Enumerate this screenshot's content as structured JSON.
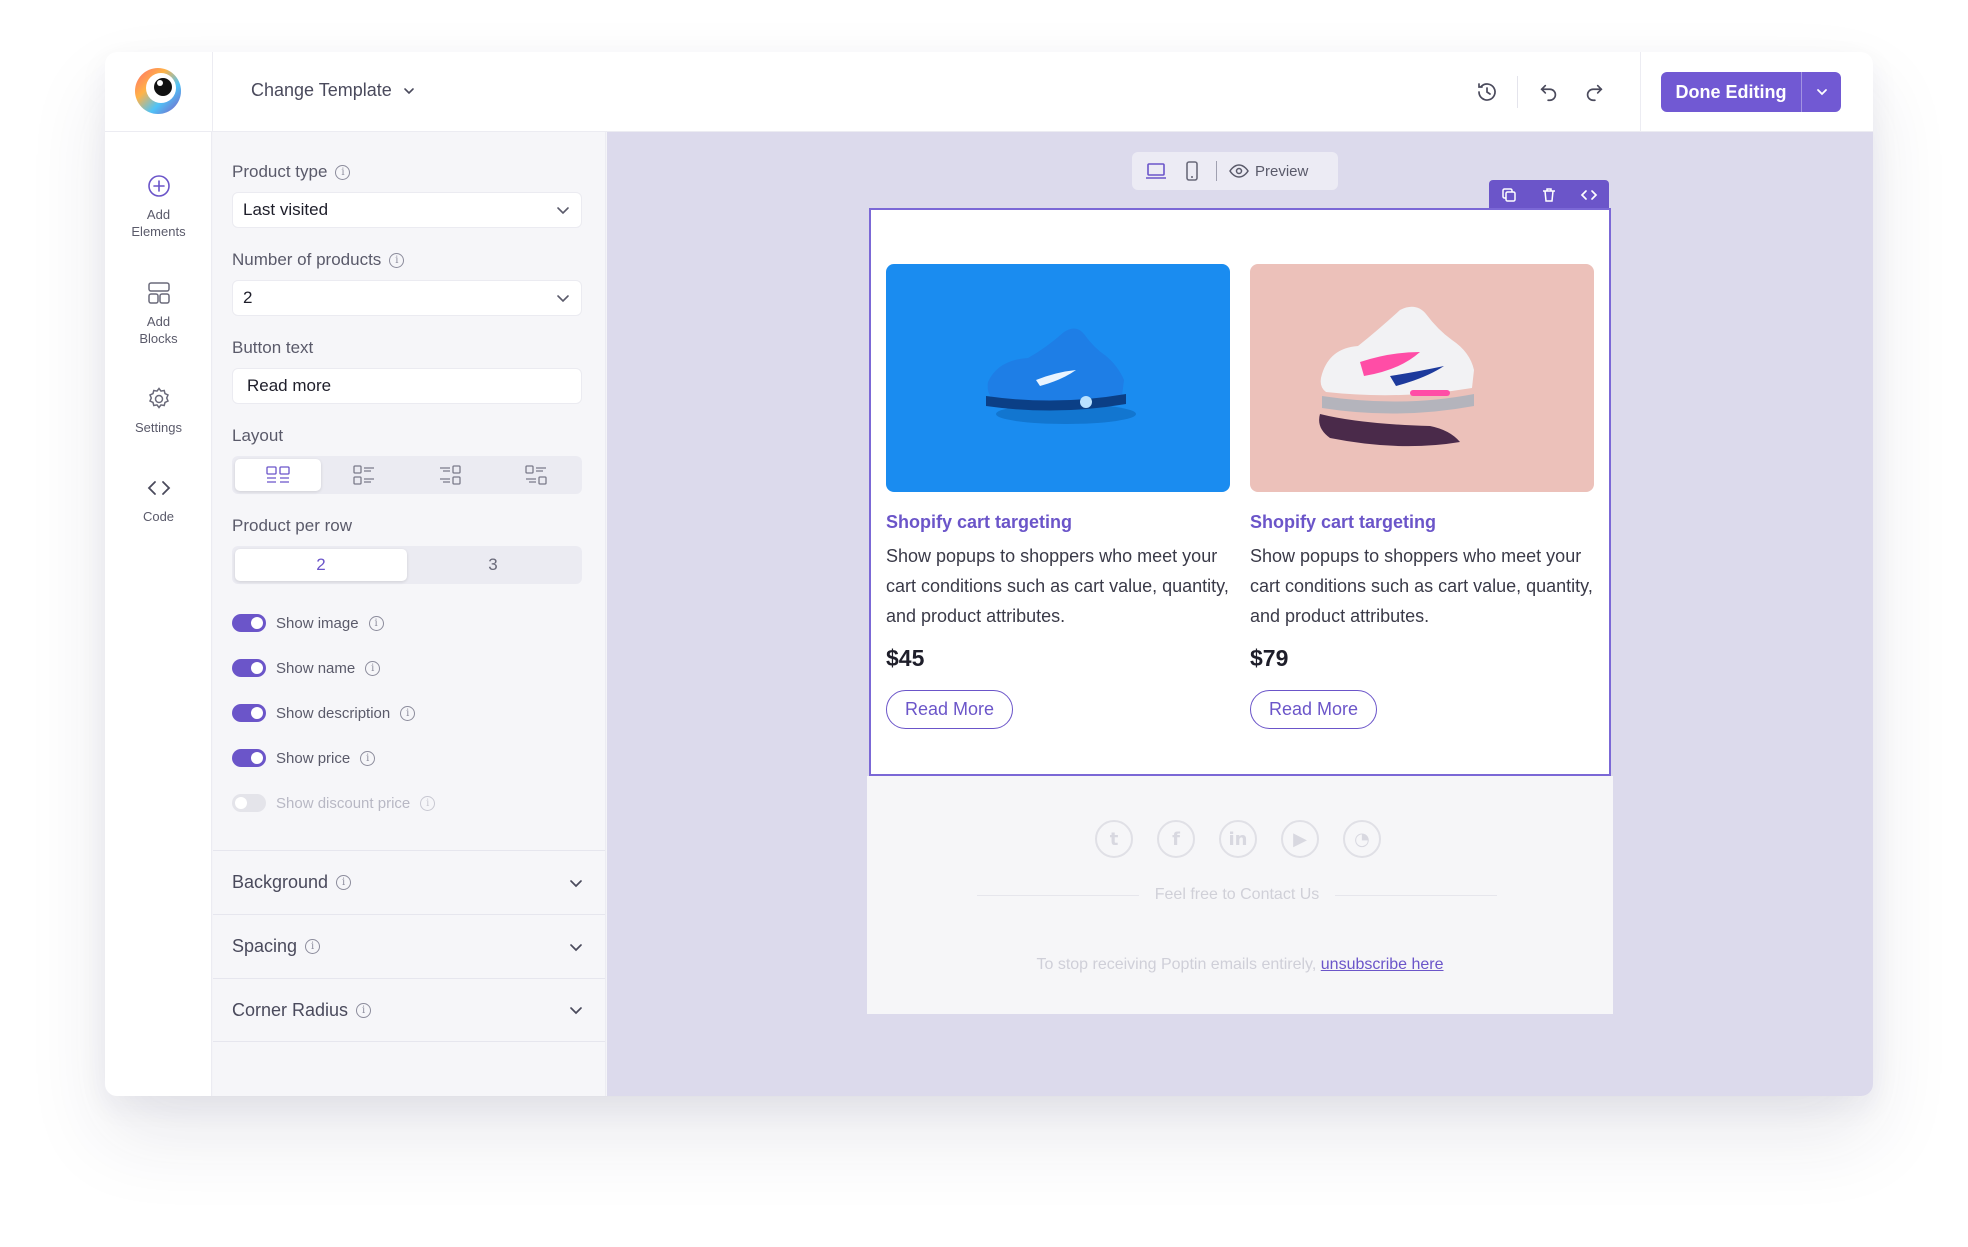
{
  "header": {
    "change_template": "Change Template",
    "done_label": "Done Editing"
  },
  "rail": {
    "items": [
      {
        "label": "Add\nElements",
        "icon": "plus-circle-icon"
      },
      {
        "label": "Add\nBlocks",
        "icon": "blocks-icon"
      },
      {
        "label": "Settings",
        "icon": "gear-icon"
      },
      {
        "label": "Code",
        "icon": "code-icon"
      }
    ]
  },
  "panel": {
    "product_type_label": "Product type",
    "product_type_value": "Last visited",
    "num_products_label": "Number of products",
    "num_products_value": "2",
    "button_text_label": "Button text",
    "button_text_value": "Read more",
    "layout_label": "Layout",
    "per_row_label": "Product per row",
    "per_row_options": [
      "2",
      "3"
    ],
    "per_row_selected": "2",
    "toggles": [
      {
        "label": "Show image",
        "on": true
      },
      {
        "label": "Show name",
        "on": true
      },
      {
        "label": "Show description",
        "on": true
      },
      {
        "label": "Show price",
        "on": true
      },
      {
        "label": "Show discount price",
        "on": false
      }
    ],
    "accordions": [
      "Background",
      "Spacing",
      "Corner Radius"
    ]
  },
  "canvas": {
    "preview_label": "Preview",
    "products": [
      {
        "name": "Shopify cart targeting",
        "description": "Show popups to shoppers who meet your cart conditions such as cart value, quantity, and product attributes.",
        "price": "$45",
        "button": "Read More"
      },
      {
        "name": "Shopify cart targeting",
        "description": "Show popups to shoppers who meet your cart conditions such as cart value, quantity, and product attributes.",
        "price": "$79",
        "button": "Read More"
      }
    ],
    "footer": {
      "contact": "Feel free to Contact Us",
      "unsub_text": "To stop receiving Poptin emails entirely,",
      "unsub_link": "unsubscribe here"
    }
  },
  "colors": {
    "accent": "#6b55c9",
    "card1_bg": "#1a8cf0",
    "card2_bg": "#ecc1ba",
    "canvas_bg": "#dcdaec"
  }
}
